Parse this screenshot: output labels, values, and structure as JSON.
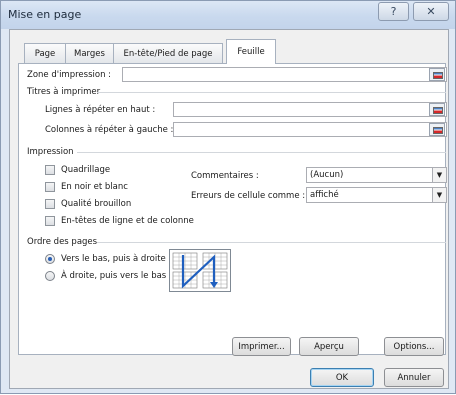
{
  "window": {
    "title": "Mise en page",
    "help_glyph": "?",
    "close_glyph": "✕"
  },
  "tabs": [
    {
      "label": "Page",
      "active": false
    },
    {
      "label": "Marges",
      "active": false
    },
    {
      "label": "En-tête/Pied de page",
      "active": false
    },
    {
      "label": "Feuille",
      "active": true
    }
  ],
  "print_area": {
    "label": "Zone d'impression :",
    "value": ""
  },
  "titles": {
    "heading": "Titres à imprimer",
    "rows_label": "Lignes à répéter en haut :",
    "rows_value": "",
    "cols_label": "Colonnes à répéter à gauche :",
    "cols_value": ""
  },
  "print": {
    "heading": "Impression",
    "checkboxes": [
      {
        "label": "Quadrillage",
        "checked": false
      },
      {
        "label": "En noir et blanc",
        "checked": false
      },
      {
        "label": "Qualité brouillon",
        "checked": false
      },
      {
        "label": "En-têtes de ligne et de colonne",
        "checked": false
      }
    ],
    "comments_label": "Commentaires :",
    "comments_value": "(Aucun)",
    "errors_label": "Erreurs de cellule comme :",
    "errors_value": "affiché"
  },
  "page_order": {
    "heading": "Ordre des pages",
    "options": [
      {
        "label": "Vers le bas, puis à droite",
        "selected": true
      },
      {
        "label": "À droite, puis vers le bas",
        "selected": false
      }
    ]
  },
  "buttons": {
    "print": "Imprimer...",
    "preview": "Aperçu",
    "options": "Options...",
    "ok": "OK",
    "cancel": "Annuler"
  }
}
